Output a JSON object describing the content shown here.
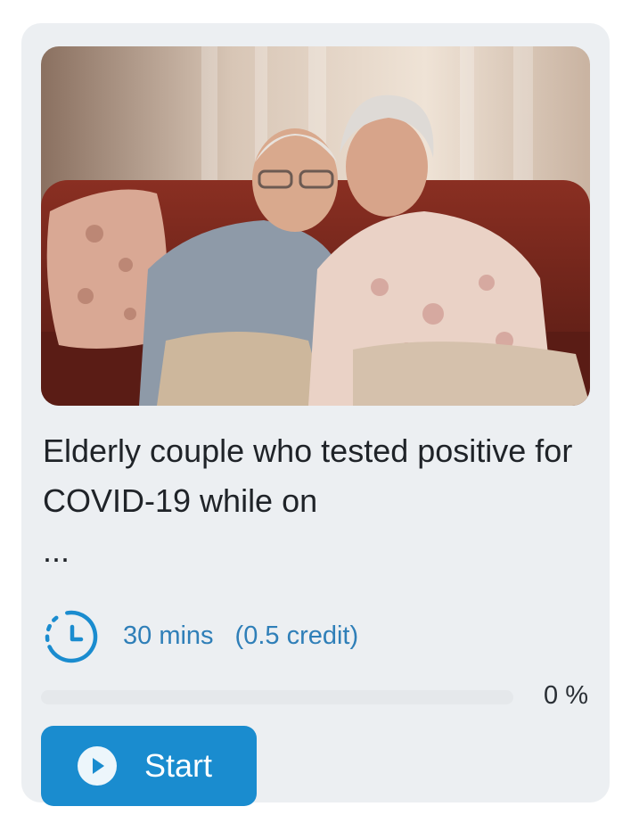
{
  "course": {
    "image_icon": "photo-elderly-couple-on-sofa",
    "title": "Elderly couple who tested positive for COVID-19 while on",
    "title_ellipsis": "...",
    "duration": "30 mins",
    "credit": "(0.5 credit)",
    "clock_icon": "clock-icon",
    "progress_percent": 0,
    "progress_label": "0 %",
    "start_label": "Start",
    "play_icon": "play-circle-icon"
  },
  "colors": {
    "card_background": "#eceff2",
    "accent": "#1a8ccf",
    "meta_text": "#2f7fb8",
    "title_text": "#1f2328"
  }
}
